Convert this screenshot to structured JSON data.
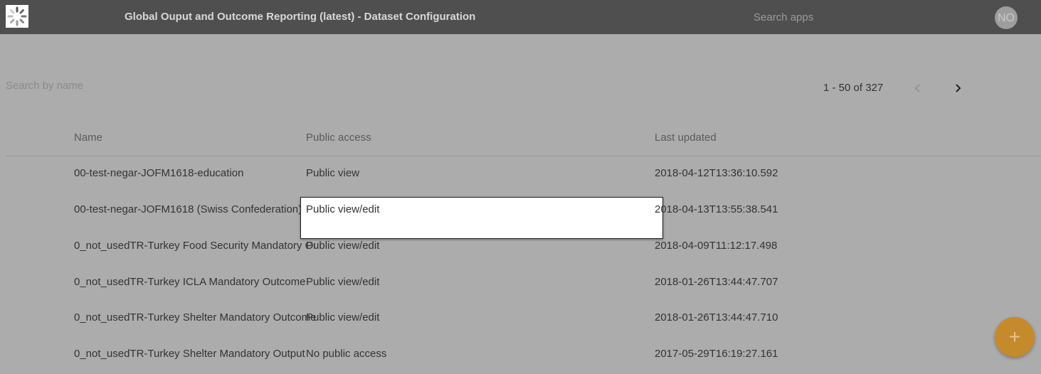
{
  "header": {
    "title": "Global Ouput and Outcome Reporting (latest) - Dataset Configuration",
    "search_placeholder": "Search apps",
    "avatar_initials": "NO"
  },
  "toolbar": {
    "search_placeholder": "Search by name",
    "pager_text": "1 - 50 of 327"
  },
  "table": {
    "columns": [
      "Name",
      "Public access",
      "Last updated"
    ],
    "rows": [
      {
        "name": "00-test-negar-JOFM1618-education",
        "access": "Public view",
        "updated": "2018-04-12T13:36:10.592"
      },
      {
        "name": "00-test-negar-JOFM1618 (Swiss Confederation)",
        "access": "Public view/edit",
        "updated": "2018-04-13T13:55:38.541"
      },
      {
        "name": "0_not_usedTR-Turkey Food Security Mandatory Outcome",
        "access": "Public view/edit",
        "updated": "2018-04-09T11:12:17.498"
      },
      {
        "name": "0_not_usedTR-Turkey ICLA Mandatory Outcome",
        "access": "Public view/edit",
        "updated": "2018-01-26T13:44:47.707"
      },
      {
        "name": "0_not_usedTR-Turkey Shelter Mandatory Outcome",
        "access": "Public view/edit",
        "updated": "2018-01-26T13:44:47.710"
      },
      {
        "name": "0_not_usedTR-Turkey Shelter Mandatory Output",
        "access": "No public access",
        "updated": "2017-05-29T16:19:27.161"
      }
    ]
  },
  "fab": {
    "label": "+"
  },
  "colors": {
    "header_bg": "#4f4f4f",
    "overlay_bg": "#acacac",
    "fab_bg": "#c58a2c"
  }
}
